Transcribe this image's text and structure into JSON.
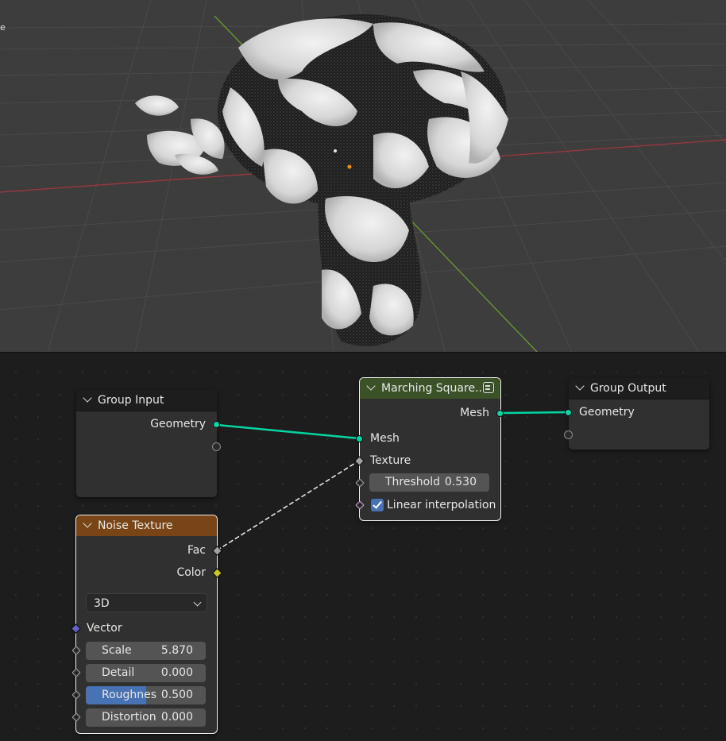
{
  "viewport": {
    "label": "e",
    "colors": {
      "background": "#3d3d3d",
      "grid": "#4a4a4a",
      "x_axis": "#a3363c",
      "y_axis": "#6c9a2b",
      "origin": "#ff8a00"
    }
  },
  "nodes": {
    "group_input": {
      "title": "Group Input",
      "outputs": [
        "Geometry"
      ]
    },
    "marching_squares": {
      "title": "Marching Square..",
      "output": "Mesh",
      "inputs": {
        "mesh": "Mesh",
        "texture": "Texture",
        "threshold_label": "Threshold",
        "threshold_value": "0.530",
        "linear_label": "Linear interpolation",
        "linear_checked": true
      },
      "header_color": "#3b5228"
    },
    "group_output": {
      "title": "Group Output",
      "inputs": [
        "Geometry"
      ]
    },
    "noise_texture": {
      "title": "Noise Texture",
      "header_color": "#7a4516",
      "outputs": {
        "fac": "Fac",
        "color": "Color"
      },
      "dimensions": "3D",
      "vector_label": "Vector",
      "params": [
        {
          "label": "Scale",
          "value": "5.870",
          "fill": 0
        },
        {
          "label": "Detail",
          "value": "0.000",
          "fill": 0
        },
        {
          "label": "Roughnes",
          "value": "0.500",
          "fill": 0.5
        },
        {
          "label": "Distortion",
          "value": "0.000",
          "fill": 0
        }
      ]
    }
  },
  "link_colors": {
    "geometry": "#00d6a3",
    "field": "#e6e6e6"
  }
}
